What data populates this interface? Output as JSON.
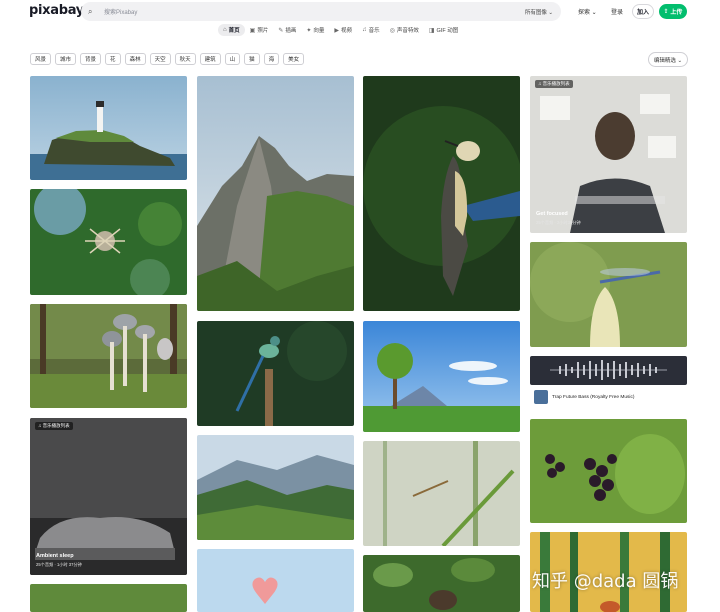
{
  "header": {
    "logo": "pixabay",
    "search_placeholder": "搜索Pixabay",
    "search_scope": "所有图像 ⌄",
    "explore": "探索 ⌄",
    "login": "登录",
    "join": "加入",
    "upload": "上传"
  },
  "tabs": [
    {
      "icon": "⌂",
      "label": "首页"
    },
    {
      "icon": "▣",
      "label": "照片"
    },
    {
      "icon": "✎",
      "label": "插画"
    },
    {
      "icon": "✦",
      "label": "向量"
    },
    {
      "icon": "▶",
      "label": "视频"
    },
    {
      "icon": "♫",
      "label": "音乐"
    },
    {
      "icon": "◎",
      "label": "声音特效"
    },
    {
      "icon": "◨",
      "label": "GIF 动图"
    }
  ],
  "chips": [
    "风景",
    "城市",
    "背景",
    "花",
    "森林",
    "天空",
    "秋天",
    "建筑",
    "山",
    "猫",
    "海",
    "美女"
  ],
  "editors_choice": "编辑精选 ⌄",
  "tiles": {
    "focused": {
      "badge": "♫ 音乐播放列表",
      "title": "Get focused",
      "sub": "25个音频 · 2小时39分钟"
    },
    "ambient": {
      "badge": "♫ 音乐播放列表",
      "title": "Ambient sleep",
      "sub": "25个音频 · 1小时 37分钟"
    },
    "audio": {
      "title": "Trap Future Bass (Royalty Free Music)"
    }
  },
  "watermark": "知乎 @dada 圆锅",
  "colors": {
    "accent": "#02be6e"
  }
}
